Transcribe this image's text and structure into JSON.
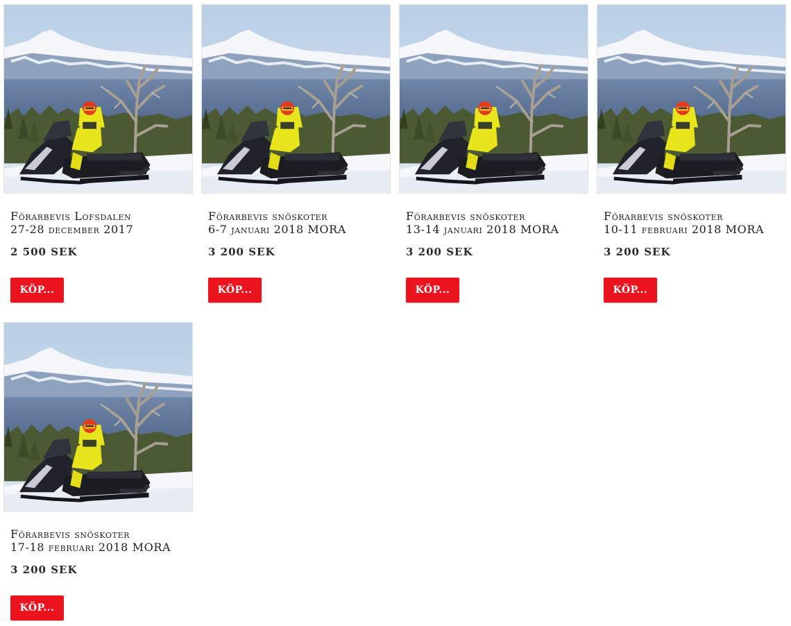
{
  "colors": {
    "buy_button_bg": "#e9141d",
    "buy_button_text": "#ffffff",
    "title_text": "#1e1e1e"
  },
  "products": [
    {
      "title_line1": "Förarbevis Lofsdalen",
      "title_line2": "27-28 december 2017",
      "price": "2 500 SEK",
      "buy_label": "KÖP...",
      "image_alt": "snowmobile-rider-in-mountains"
    },
    {
      "title_line1": "Förarbevis snöskoter",
      "title_line2": "6-7 januari 2018 MORA",
      "price": "3 200 SEK",
      "buy_label": "KÖP...",
      "image_alt": "snowmobile-rider-in-mountains"
    },
    {
      "title_line1": "Förarbevis snöskoter",
      "title_line2": "13-14 januari 2018 MORA",
      "price": "3 200 SEK",
      "buy_label": "KÖP...",
      "image_alt": "snowmobile-rider-in-mountains"
    },
    {
      "title_line1": "Förarbevis snöskoter",
      "title_line2": "10-11 februari 2018 MORA",
      "price": "3 200 SEK",
      "buy_label": "KÖP...",
      "image_alt": "snowmobile-rider-in-mountains"
    },
    {
      "title_line1": "Förarbevis snöskoter",
      "title_line2": "17-18 februari 2018 MORA",
      "price": "3 200 SEK",
      "buy_label": "KÖP...",
      "image_alt": "snowmobile-rider-in-mountains"
    }
  ]
}
